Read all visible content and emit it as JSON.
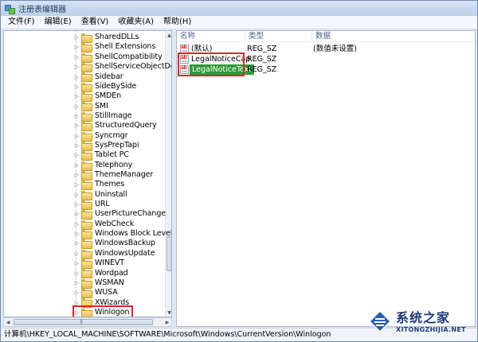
{
  "window": {
    "title": "注册表编辑器"
  },
  "menu": [
    "文件(F)",
    "编辑(E)",
    "查看(V)",
    "收藏夹(A)",
    "帮助(H)"
  ],
  "tree": {
    "items": [
      "SharedDLLs",
      "Shell Extensions",
      "ShellCompatibility",
      "ShellServiceObjectDelayL",
      "Sidebar",
      "SideBySide",
      "SMDEn",
      "SMI",
      "StillImage",
      "StructuredQuery",
      "Syncmgr",
      "SysPrepTapi",
      "Tablet PC",
      "Telephony",
      "ThemeManager",
      "Themes",
      "Uninstall",
      "URL",
      "UserPictureChange",
      "WebCheck",
      "Windows Block Level Bac",
      "WindowsBackup",
      "WindowsUpdate",
      "WINEVT",
      "Wordpad",
      "WSMAN",
      "WUSA",
      "XWizards",
      "Winlogon"
    ],
    "highlighted": "Winlogon"
  },
  "values": {
    "headers": {
      "name": "名称",
      "type": "类型",
      "data": "数据"
    },
    "rows": [
      {
        "name": "(默认)",
        "type": "REG_SZ",
        "data": "(数值未设置)"
      },
      {
        "name": "LegalNoticeCap...",
        "type": "REG_SZ",
        "data": ""
      },
      {
        "name": "LegalNoticeText",
        "type": "REG_SZ",
        "data": "",
        "selected": true
      }
    ]
  },
  "status": {
    "path": "计算机\\HKEY_LOCAL_MACHINE\\SOFTWARE\\Microsoft\\Windows\\CurrentVersion\\Winlogon"
  },
  "watermark": {
    "title": "系统之家",
    "url": "XITONGZHIJIA.NET"
  },
  "colors": {
    "highlight_border": "#e5222b",
    "selected_bg": "#2f9a3a",
    "title_gradient_top": "#d7e4f4"
  }
}
